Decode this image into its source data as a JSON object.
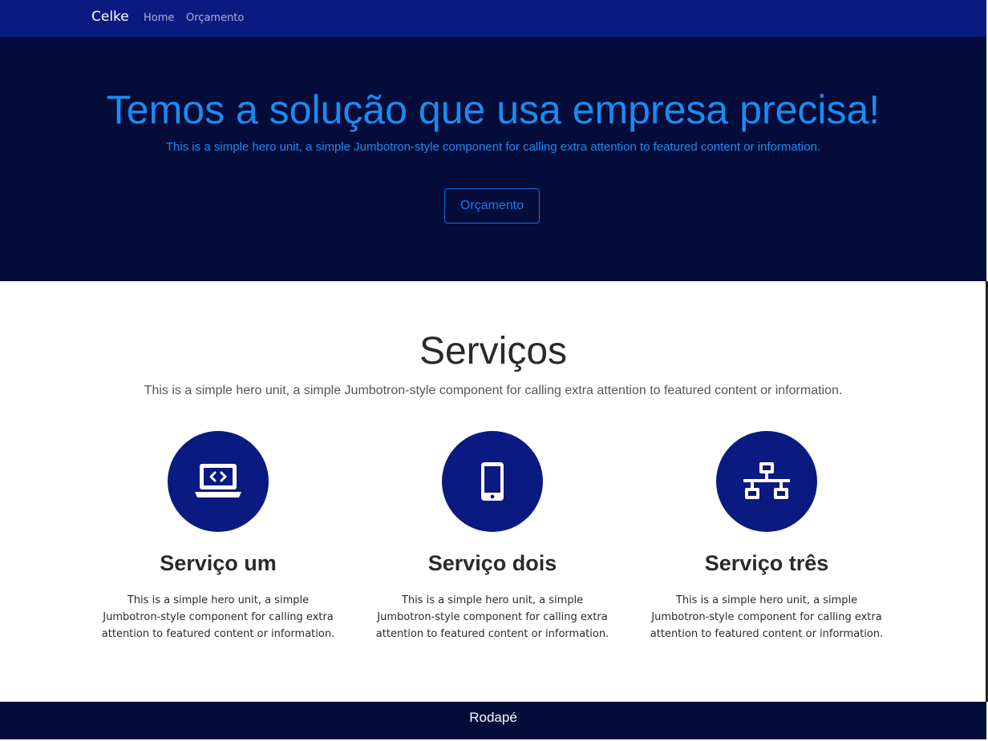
{
  "navbar": {
    "brand": "Celke",
    "links": [
      "Home",
      "Orçamento"
    ]
  },
  "hero": {
    "title": "Temos a solução que usa empresa precisa!",
    "lead": "This is a simple hero unit, a simple Jumbotron-style component for calling extra attention to featured content or information.",
    "button_label": "Orçamento"
  },
  "services": {
    "title": "Serviços",
    "lead": "This is a simple hero unit, a simple Jumbotron-style component for calling extra attention to featured content or information.",
    "items": [
      {
        "icon": "laptop-code-icon",
        "title": "Serviço um",
        "text": "This is a simple hero unit, a simple Jumbotron-style component for calling extra attention to featured content or information."
      },
      {
        "icon": "mobile-phone-icon",
        "title": "Serviço dois",
        "text": "This is a simple hero unit, a simple Jumbotron-style component for calling extra attention to featured content or information."
      },
      {
        "icon": "network-icon",
        "title": "Serviço três",
        "text": "This is a simple hero unit, a simple Jumbotron-style component for calling extra attention to featured content or information."
      }
    ]
  },
  "footer": {
    "text": "Rodapé"
  },
  "colors": {
    "navbar_bg": "#0a1a80",
    "hero_bg": "#040c3a",
    "accent": "#1a8cf0",
    "circle_bg": "#0a1a80"
  }
}
